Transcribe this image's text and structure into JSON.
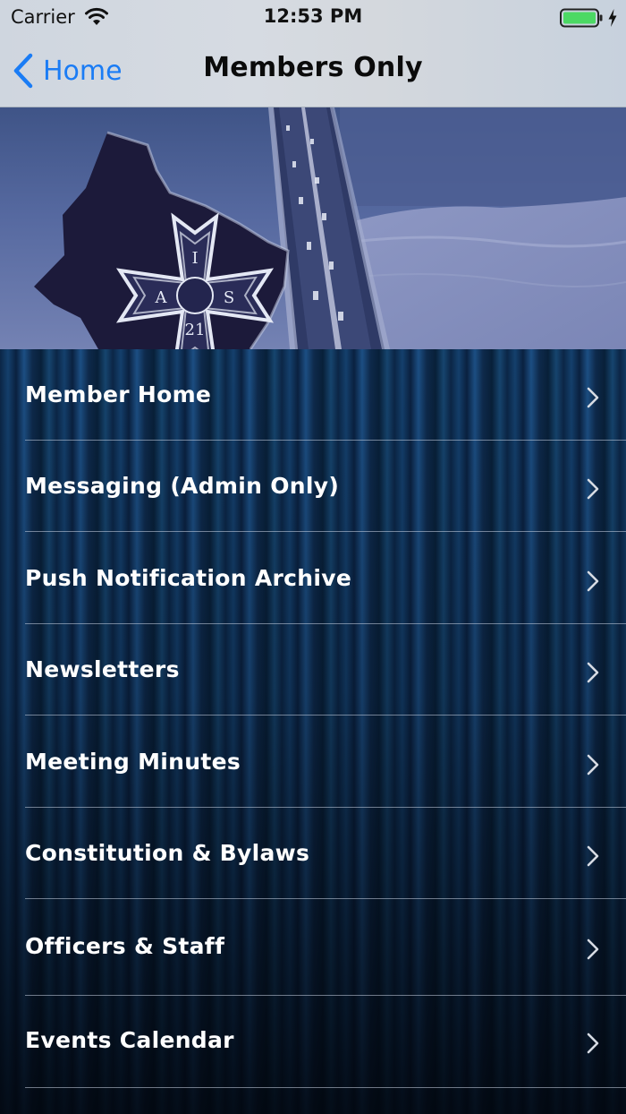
{
  "status_bar": {
    "carrier": "Carrier",
    "time": "12:53 PM",
    "battery_color": "#4cd964"
  },
  "nav": {
    "back_label": "Home",
    "title": "Members Only",
    "accent_color": "#1a7cf5"
  },
  "hero": {
    "emblem_number": "21",
    "emblem_letters": [
      "I",
      "A",
      "T",
      "S"
    ]
  },
  "menu": {
    "items": [
      {
        "label": "Member Home",
        "icon": "chevron-right-icon"
      },
      {
        "label": "Messaging (Admin Only)",
        "icon": "chevron-right-icon"
      },
      {
        "label": "Push Notification Archive",
        "icon": "chevron-right-icon"
      },
      {
        "label": "Newsletters",
        "icon": "chevron-right-icon"
      },
      {
        "label": "Meeting Minutes",
        "icon": "chevron-right-icon"
      },
      {
        "label": "Constitution & Bylaws",
        "icon": "chevron-right-icon"
      },
      {
        "label": "Officers & Staff",
        "icon": "chevron-right-icon"
      },
      {
        "label": "Events Calendar",
        "icon": "chevron-right-icon"
      }
    ]
  }
}
